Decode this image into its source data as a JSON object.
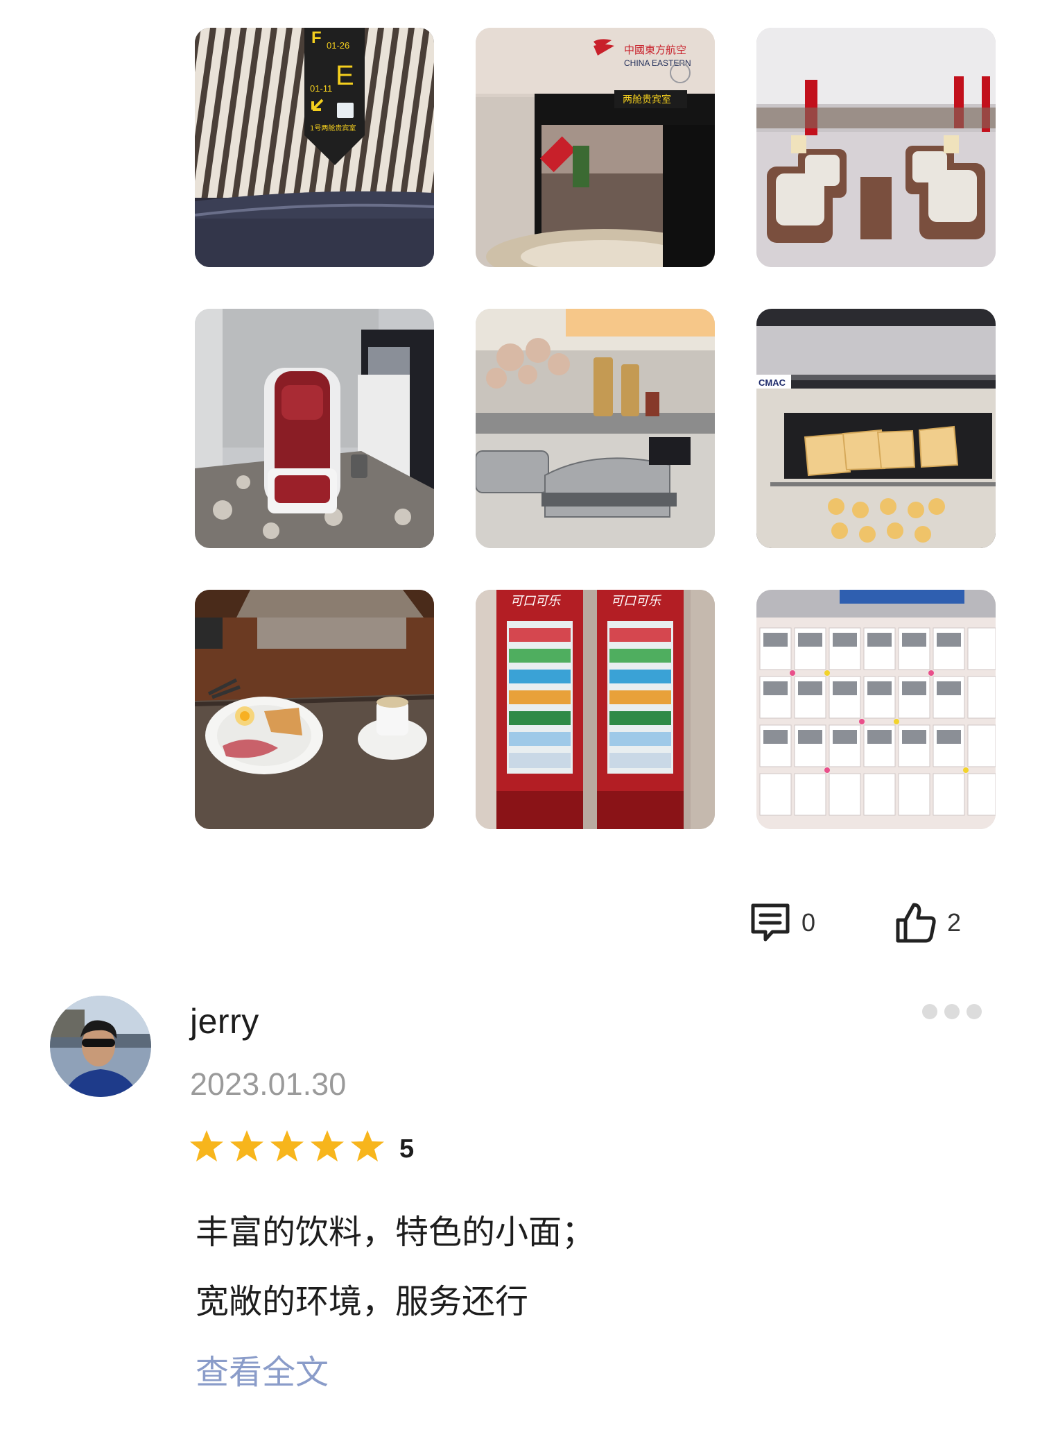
{
  "photos": [
    {
      "icon": "photo-signage",
      "sign_texts": [
        "F",
        "01-26",
        "E",
        "01-11",
        "1号两舱贵宾室"
      ]
    },
    {
      "icon": "photo-lounge-entrance",
      "sign_texts": [
        "中國東方航空",
        "CHINA EASTERN",
        "两舱贵宾室"
      ]
    },
    {
      "icon": "photo-seating-area"
    },
    {
      "icon": "photo-massage-chair"
    },
    {
      "icon": "photo-buffet-counter"
    },
    {
      "icon": "photo-bread-display",
      "sign_texts": [
        "CMAC"
      ]
    },
    {
      "icon": "photo-meal-plate"
    },
    {
      "icon": "photo-drinks-fridge",
      "sign_texts": [
        "可口可乐",
        "可口可乐"
      ]
    },
    {
      "icon": "photo-message-board"
    }
  ],
  "actions": {
    "comment_count": "0",
    "like_count": "2",
    "comment_icon": "comment-icon",
    "like_icon": "thumbs-up-icon"
  },
  "review": {
    "username": "jerry",
    "date": "2023.01.30",
    "rating_value": 5,
    "rating_label": "5",
    "lines": [
      "丰富的饮料，特色的小面；",
      "宽敞的环境，服务还行"
    ],
    "read_more": "查看全文"
  },
  "colors": {
    "star": "#f7b51c",
    "link": "#8a9cc9",
    "muted": "#9a9a9a",
    "more_dots": "#dcdcdc"
  }
}
